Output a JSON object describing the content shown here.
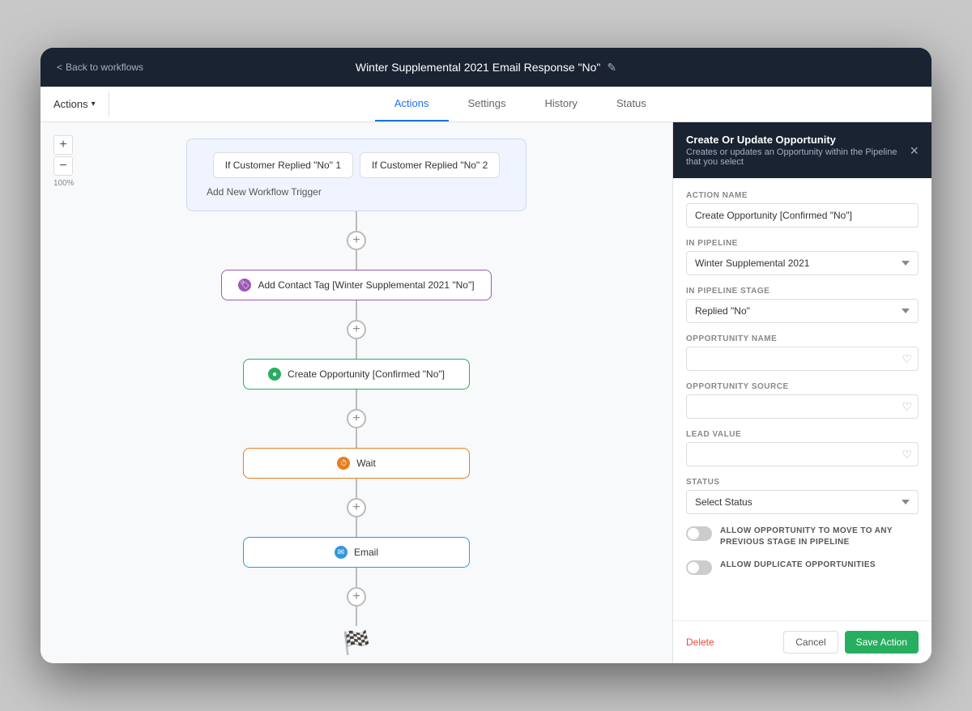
{
  "top_bar": {
    "back_label": "Back to workflows",
    "title": "Winter Supplemental 2021 Email Response \"No\"",
    "edit_icon": "✎"
  },
  "tabs": {
    "actions_dropdown": "Actions",
    "items": [
      {
        "id": "actions",
        "label": "Actions",
        "active": true
      },
      {
        "id": "settings",
        "label": "Settings",
        "active": false
      },
      {
        "id": "history",
        "label": "History",
        "active": false
      },
      {
        "id": "status",
        "label": "Status",
        "active": false
      }
    ]
  },
  "canvas": {
    "zoom_in": "+",
    "zoom_out": "−",
    "zoom_level": "100%",
    "triggers": [
      {
        "label": "If Customer Replied \"No\" 1"
      },
      {
        "label": "If Customer Replied \"No\" 2"
      }
    ],
    "add_trigger_label": "Add New Workflow Trigger",
    "nodes": [
      {
        "id": "tag",
        "type": "tag",
        "icon_color": "purple",
        "icon_char": "🏷",
        "label": "Add Contact Tag [Winter Supplemental 2021 \"No\"]"
      },
      {
        "id": "opportunity",
        "type": "opportunity",
        "icon_color": "green",
        "icon_char": "●",
        "label": "Create Opportunity [Confirmed \"No\"]"
      },
      {
        "id": "wait",
        "type": "wait",
        "icon_color": "orange",
        "icon_char": "⏱",
        "label": "Wait"
      },
      {
        "id": "email",
        "type": "email",
        "icon_color": "blue",
        "icon_char": "✉",
        "label": "Email"
      }
    ]
  },
  "panel": {
    "title": "Create Or Update Opportunity",
    "subtitle": "Creates or updates an Opportunity within the Pipeline that you select",
    "close_icon": "×",
    "fields": {
      "action_name_label": "ACTION NAME",
      "action_name_value": "Create Opportunity [Confirmed \"No\"]",
      "pipeline_label": "IN PIPELINE",
      "pipeline_value": "Winter Supplemental 2021",
      "pipeline_stage_label": "IN PIPELINE STAGE",
      "pipeline_stage_value": "Replied \"No\"",
      "opportunity_name_label": "OPPORTUNITY NAME",
      "opportunity_name_value": "",
      "opportunity_name_placeholder": "",
      "opportunity_source_label": "OPPORTUNITY SOURCE",
      "opportunity_source_value": "",
      "lead_value_label": "LEAD VALUE",
      "lead_value_value": "",
      "status_label": "STATUS",
      "status_value": "Select Status",
      "toggle1_label": "ALLOW OPPORTUNITY TO MOVE TO ANY PREVIOUS STAGE IN PIPELINE",
      "toggle2_label": "ALLOW DUPLICATE OPPORTUNITIES"
    },
    "footer": {
      "delete_label": "Delete",
      "cancel_label": "Cancel",
      "save_label": "Save Action"
    }
  }
}
